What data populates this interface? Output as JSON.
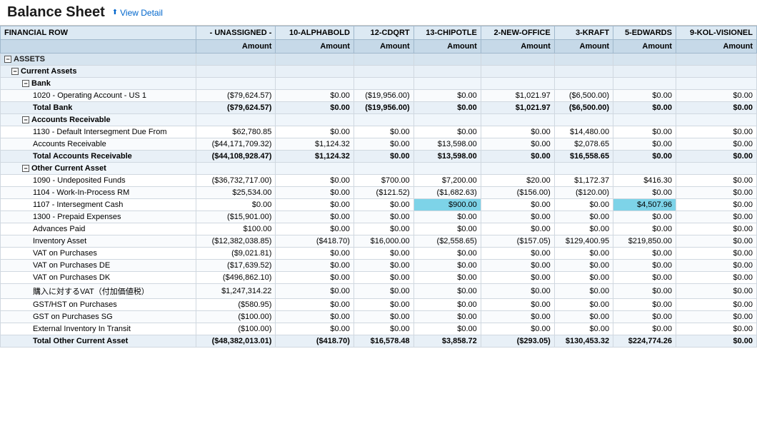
{
  "header": {
    "title": "Balance Sheet",
    "view_detail_label": "View Detail"
  },
  "columns": {
    "financial_row": "FINANCIAL ROW",
    "col1": "- UNASSIGNED -",
    "col2": "10-ALPHABOLD",
    "col3": "12-CDQRT",
    "col4": "13-CHIPOTLE",
    "col5": "2-NEW-OFFICE",
    "col6": "3-KRAFT",
    "col7": "5-EDWARDS",
    "col8": "9-KOL-VISIONEL",
    "amount": "Amount"
  },
  "rows": [
    {
      "type": "section",
      "label": "ASSETS",
      "indent": 0,
      "expand": true,
      "values": [
        "",
        "",
        "",
        "",
        "",
        "",
        "",
        ""
      ]
    },
    {
      "type": "group",
      "label": "Current Assets",
      "indent": 1,
      "expand": true,
      "values": [
        "",
        "",
        "",
        "",
        "",
        "",
        "",
        ""
      ]
    },
    {
      "type": "subgroup",
      "label": "Bank",
      "indent": 2,
      "expand": true,
      "values": [
        "",
        "",
        "",
        "",
        "",
        "",
        "",
        ""
      ]
    },
    {
      "type": "data",
      "label": "1020 - Operating Account - US 1",
      "indent": 3,
      "values": [
        "($79,624.57)",
        "$0.00",
        "($19,956.00)",
        "$0.00",
        "$1,021.97",
        "($6,500.00)",
        "$0.00",
        "$0.00"
      ]
    },
    {
      "type": "total",
      "label": "Total Bank",
      "indent": 3,
      "values": [
        "($79,624.57)",
        "$0.00",
        "($19,956.00)",
        "$0.00",
        "$1,021.97",
        "($6,500.00)",
        "$0.00",
        "$0.00"
      ]
    },
    {
      "type": "subgroup",
      "label": "Accounts Receivable",
      "indent": 2,
      "expand": true,
      "values": [
        "",
        "",
        "",
        "",
        "",
        "",
        "",
        ""
      ]
    },
    {
      "type": "data",
      "label": "1130 - Default Intersegment Due From",
      "indent": 3,
      "values": [
        "$62,780.85",
        "$0.00",
        "$0.00",
        "$0.00",
        "$0.00",
        "$14,480.00",
        "$0.00",
        "$0.00"
      ]
    },
    {
      "type": "data",
      "label": "Accounts Receivable",
      "indent": 3,
      "values": [
        "($44,171,709.32)",
        "$1,124.32",
        "$0.00",
        "$13,598.00",
        "$0.00",
        "$2,078.65",
        "$0.00",
        "$0.00"
      ]
    },
    {
      "type": "total",
      "label": "Total Accounts Receivable",
      "indent": 3,
      "values": [
        "($44,108,928.47)",
        "$1,124.32",
        "$0.00",
        "$13,598.00",
        "$0.00",
        "$16,558.65",
        "$0.00",
        "$0.00"
      ]
    },
    {
      "type": "subgroup",
      "label": "Other Current Asset",
      "indent": 2,
      "expand": true,
      "values": [
        "",
        "",
        "",
        "",
        "",
        "",
        "",
        ""
      ]
    },
    {
      "type": "data",
      "label": "1090 - Undeposited Funds",
      "indent": 3,
      "values": [
        "($36,732,717.00)",
        "$0.00",
        "$700.00",
        "$7,200.00",
        "$20.00",
        "$1,172.37",
        "$416.30",
        "$0.00"
      ]
    },
    {
      "type": "data",
      "label": "1104 - Work-In-Process RM",
      "indent": 3,
      "values": [
        "$25,534.00",
        "$0.00",
        "($121.52)",
        "($1,682.63)",
        "($156.00)",
        "($120.00)",
        "$0.00",
        "$0.00"
      ]
    },
    {
      "type": "data",
      "label": "1107 - Intersegment Cash",
      "indent": 3,
      "highlight": [
        3,
        6
      ],
      "values": [
        "$0.00",
        "$0.00",
        "$0.00",
        "$900.00",
        "$0.00",
        "$0.00",
        "$4,507.96",
        "$0.00"
      ]
    },
    {
      "type": "data",
      "label": "1300 - Prepaid Expenses",
      "indent": 3,
      "values": [
        "($15,901.00)",
        "$0.00",
        "$0.00",
        "$0.00",
        "$0.00",
        "$0.00",
        "$0.00",
        "$0.00"
      ]
    },
    {
      "type": "data",
      "label": "Advances Paid",
      "indent": 3,
      "values": [
        "$100.00",
        "$0.00",
        "$0.00",
        "$0.00",
        "$0.00",
        "$0.00",
        "$0.00",
        "$0.00"
      ]
    },
    {
      "type": "data",
      "label": "Inventory Asset",
      "indent": 3,
      "values": [
        "($12,382,038.85)",
        "($418.70)",
        "$16,000.00",
        "($2,558.65)",
        "($157.05)",
        "$129,400.95",
        "$219,850.00",
        "$0.00"
      ]
    },
    {
      "type": "data",
      "label": "VAT on Purchases",
      "indent": 3,
      "values": [
        "($9,021.81)",
        "$0.00",
        "$0.00",
        "$0.00",
        "$0.00",
        "$0.00",
        "$0.00",
        "$0.00"
      ]
    },
    {
      "type": "data",
      "label": "VAT on Purchases DE",
      "indent": 3,
      "values": [
        "($17,639.52)",
        "$0.00",
        "$0.00",
        "$0.00",
        "$0.00",
        "$0.00",
        "$0.00",
        "$0.00"
      ]
    },
    {
      "type": "data",
      "label": "VAT on Purchases DK",
      "indent": 3,
      "values": [
        "($496,862.10)",
        "$0.00",
        "$0.00",
        "$0.00",
        "$0.00",
        "$0.00",
        "$0.00",
        "$0.00"
      ]
    },
    {
      "type": "data",
      "label": "購入に対するVAT（付加価値税）",
      "indent": 3,
      "values": [
        "$1,247,314.22",
        "$0.00",
        "$0.00",
        "$0.00",
        "$0.00",
        "$0.00",
        "$0.00",
        "$0.00"
      ]
    },
    {
      "type": "data",
      "label": "GST/HST on Purchases",
      "indent": 3,
      "values": [
        "($580.95)",
        "$0.00",
        "$0.00",
        "$0.00",
        "$0.00",
        "$0.00",
        "$0.00",
        "$0.00"
      ]
    },
    {
      "type": "data",
      "label": "GST on Purchases SG",
      "indent": 3,
      "values": [
        "($100.00)",
        "$0.00",
        "$0.00",
        "$0.00",
        "$0.00",
        "$0.00",
        "$0.00",
        "$0.00"
      ]
    },
    {
      "type": "data",
      "label": "External Inventory In Transit",
      "indent": 3,
      "values": [
        "($100.00)",
        "$0.00",
        "$0.00",
        "$0.00",
        "$0.00",
        "$0.00",
        "$0.00",
        "$0.00"
      ]
    },
    {
      "type": "total",
      "label": "Total Other Current Asset",
      "indent": 3,
      "values": [
        "($48,382,013.01)",
        "($418.70)",
        "$16,578.48",
        "$3,858.72",
        "($293.05)",
        "$130,453.32",
        "$224,774.26",
        "$0.00"
      ]
    }
  ]
}
